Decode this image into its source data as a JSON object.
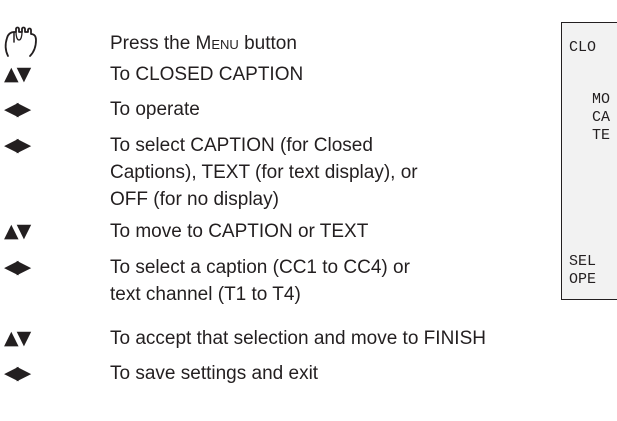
{
  "instructions": [
    {
      "icon": "hand-press-icon",
      "text_lines": [
        "Press the ",
        "Menu",
        " button"
      ]
    },
    {
      "icon": "up-down-arrows-icon",
      "glyph": "▲▼",
      "text_lines": [
        "To CLOSED CAPTION"
      ]
    },
    {
      "icon": "left-right-arrows-icon",
      "glyph": "◀▶",
      "text_lines": [
        "To operate"
      ]
    },
    {
      "icon": "left-right-arrows-icon",
      "glyph": "◀▶",
      "text_lines": [
        "To select CAPTION (for Closed",
        "Captions), TEXT (for text display), or",
        "OFF (for no display)"
      ]
    },
    {
      "icon": "up-down-arrows-icon",
      "glyph": "▲▼",
      "text_lines": [
        "To move to CAPTION or TEXT"
      ]
    },
    {
      "icon": "left-right-arrows-icon",
      "glyph": "◀▶",
      "text_lines": [
        "To select a caption (CC1 to CC4) or",
        "text channel (T1 to T4)"
      ]
    },
    {
      "icon": "up-down-arrows-icon",
      "glyph": "▲▼",
      "text_lines": [
        "To accept that selection and move to FINISH"
      ]
    },
    {
      "icon": "left-right-arrows-icon",
      "glyph": "◀▶",
      "text_lines": [
        "To save settings and exit"
      ]
    }
  ],
  "osd_menu": {
    "lines": [
      "CLO",
      "MO",
      "CA",
      "TE",
      "SEL",
      "OPE"
    ]
  },
  "colors": {
    "text": "#231f20",
    "panel_background": "#f2f2f2"
  }
}
